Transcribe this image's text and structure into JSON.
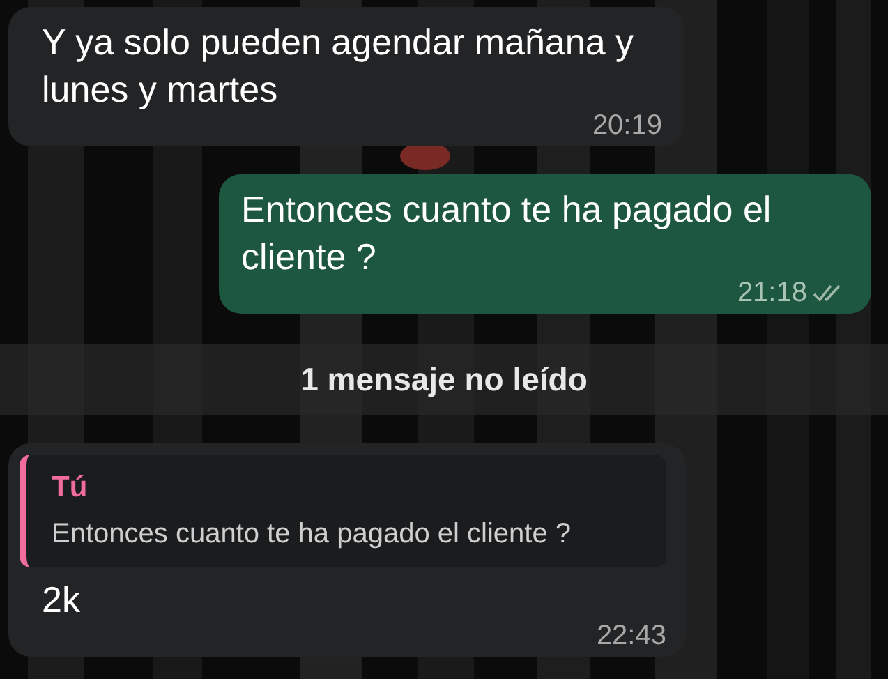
{
  "messages": [
    {
      "kind": "text",
      "outgoing": false,
      "text": "Y ya solo pueden agendar mañana y lunes y martes",
      "time": "20:19"
    },
    {
      "kind": "text",
      "outgoing": true,
      "text": "Entonces cuanto te ha pagado el cliente ?",
      "time": "21:18",
      "read": false
    },
    {
      "kind": "unread_divider",
      "text": "1 mensaje no leído"
    },
    {
      "kind": "reply",
      "outgoing": false,
      "quote": {
        "author": "Tú",
        "text": "Entonces cuanto te ha pagado el cliente ?"
      },
      "text": "2k",
      "time": "22:43"
    }
  ]
}
